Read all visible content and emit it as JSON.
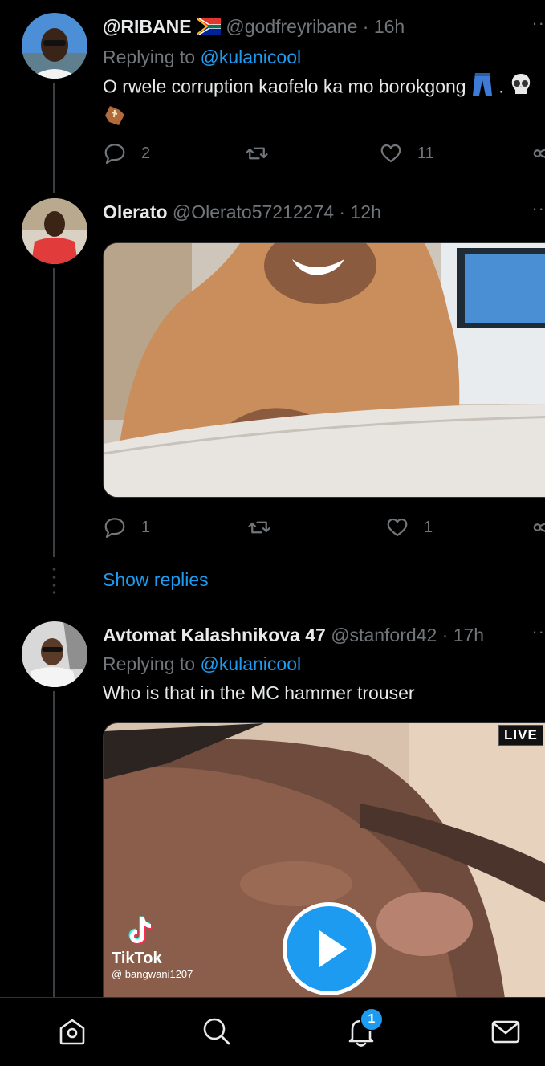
{
  "tweets": [
    {
      "name": "@RIBANE",
      "handle": "@godfreyribane",
      "sep": "·",
      "time": "16h",
      "replying_prefix": "Replying to",
      "replying_to": "@kulanicool",
      "text": "O rwele corruption kaofelo ka mo borokgong",
      "text_suffix": ".",
      "emojis": [
        "jeans-emoji",
        "skull-emoji",
        "coffin-emoji",
        "south-africa-flag-emoji"
      ],
      "replies": "2",
      "likes": "11"
    },
    {
      "name": "Olerato",
      "handle": "@Olerato57212274",
      "sep": "·",
      "time": "12h",
      "media_description": "baby-laughing-in-high-chair",
      "replies": "1",
      "likes": "1"
    },
    {
      "name": "Avtomat Kalashnikova 47",
      "handle": "@stanford42",
      "sep": "·",
      "time": "17h",
      "replying_prefix": "Replying to",
      "replying_to": "@kulanicool",
      "text": "Who is that in the MC hammer trouser",
      "video": {
        "live_label": "LIVE",
        "tiktok_label": "TikTok",
        "tiktok_user": "@ bangwani1207"
      }
    }
  ],
  "show_replies": "Show replies",
  "nav": {
    "items": [
      "home-icon",
      "search-icon",
      "notifications-icon",
      "messages-icon"
    ],
    "notification_badge": "1"
  },
  "colors": {
    "background": "#000000",
    "accent": "#1d9bf0",
    "muted": "#71767b",
    "text": "#e7e9ea"
  }
}
